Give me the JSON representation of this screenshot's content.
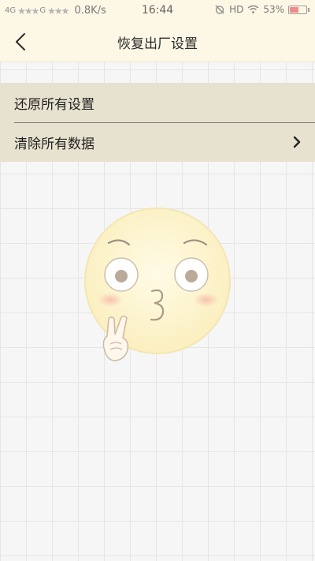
{
  "status_bar": {
    "signal_1": "4G",
    "signal_2": "G",
    "stars": "★★★",
    "speed": "0.8K/s",
    "time": "16:44",
    "hd": "HD",
    "battery": "53%",
    "battery_level": 0.53
  },
  "header": {
    "title": "恢复出厂设置",
    "back_icon": "chevron-left-icon"
  },
  "menu": {
    "items": [
      {
        "label": "还原所有设置",
        "has_chevron": false
      },
      {
        "label": "清除所有数据",
        "has_chevron": true,
        "chevron_icon": "chevron-right-icon"
      }
    ]
  },
  "illustration": {
    "icon": "kissing-emoji-peace-sign",
    "accent_color": "#fbf0c4"
  },
  "colors": {
    "header_bg": "#fdf8e5",
    "menu_bg": "#e7e2cf",
    "page_bg": "#f6f6f6",
    "grid_line": "#e6e6e6",
    "divider": "#7d7a70"
  }
}
